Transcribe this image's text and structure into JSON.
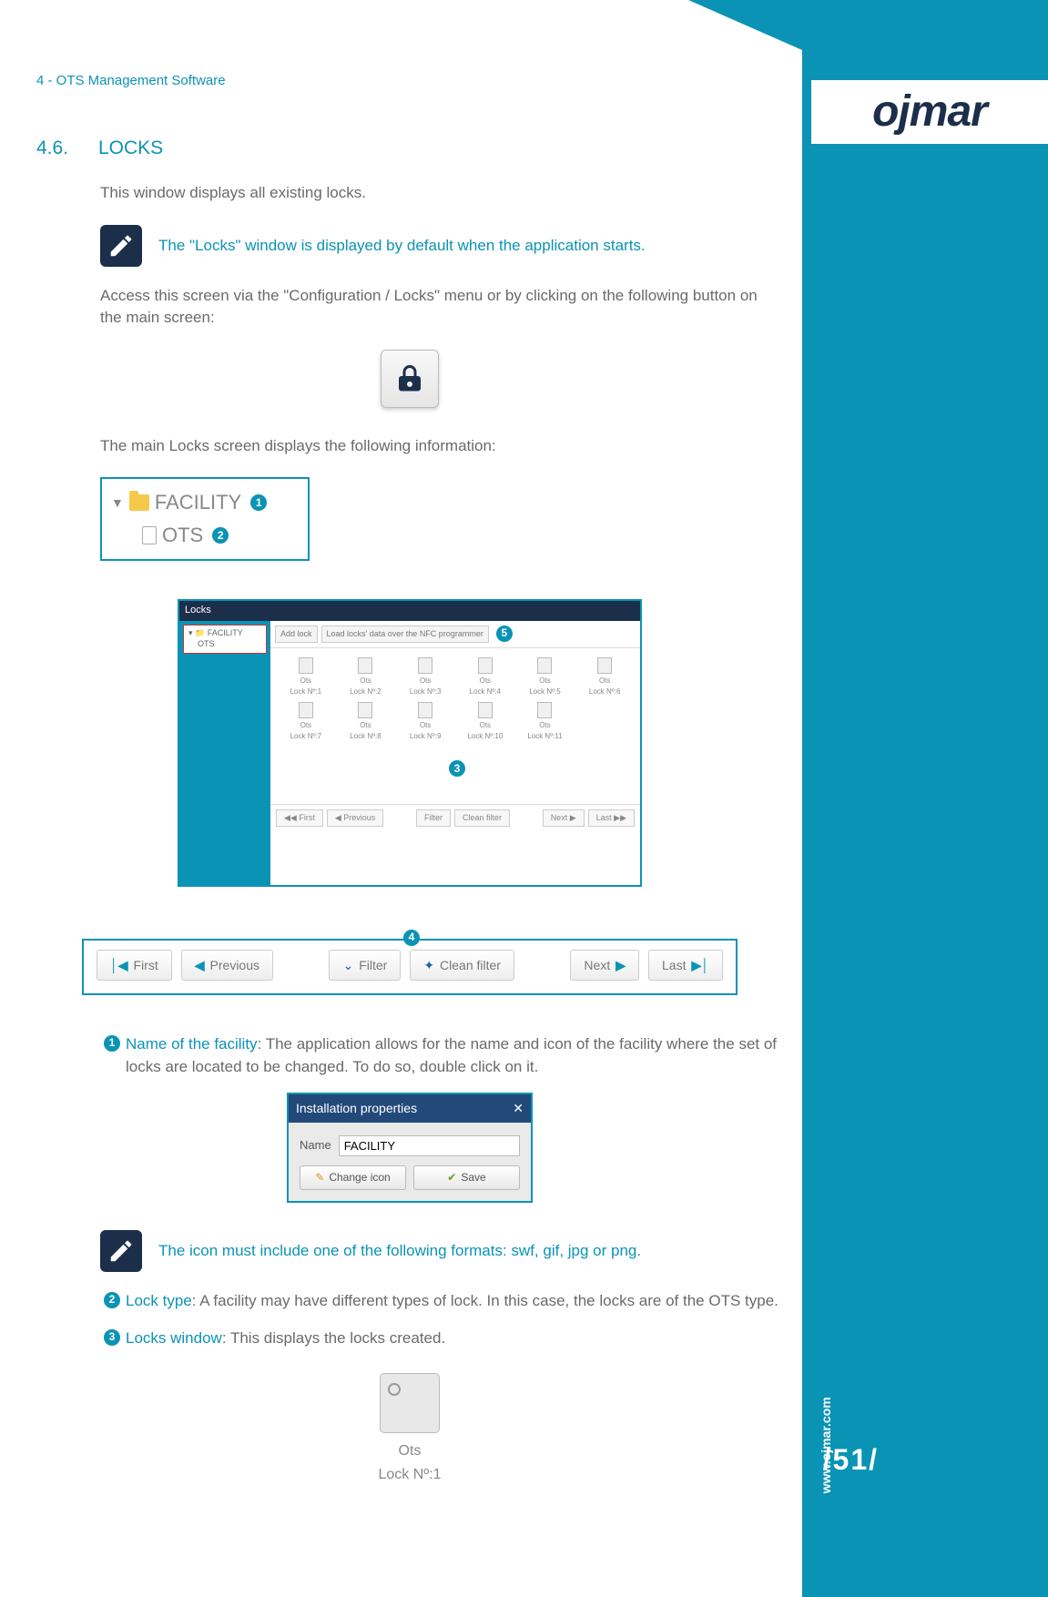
{
  "header": {
    "breadcrumb": "4 - OTS Management Software"
  },
  "logo": {
    "text": "ojmar"
  },
  "side": {
    "url": "www.ojmar.com",
    "page": "/51/"
  },
  "section": {
    "number": "4.6.",
    "title": "LOCKS"
  },
  "intro": "This window displays all existing locks.",
  "note1": "The \"Locks\" window is displayed by default when the application starts.",
  "access1": "Access this screen via the \"Configuration / Locks\" menu or by clicking on the following button on the main screen:",
  "mainInfo": "The main Locks screen displays the following information:",
  "tree": {
    "facility": "FACILITY",
    "ots": "OTS"
  },
  "locksWindow": {
    "title": "Locks",
    "sideTree": {
      "top": "▾ 📁 FACILITY",
      "sub": "OTS"
    },
    "topButtons": [
      "Add lock",
      "Load locks' data over the NFC programmer"
    ],
    "items": [
      {
        "t": "Ots",
        "n": "Lock Nº:1"
      },
      {
        "t": "Ots",
        "n": "Lock Nº:2"
      },
      {
        "t": "Ots",
        "n": "Lock Nº:3"
      },
      {
        "t": "Ots",
        "n": "Lock Nº:4"
      },
      {
        "t": "Ots",
        "n": "Lock Nº:5"
      },
      {
        "t": "Ots",
        "n": "Lock Nº:6"
      },
      {
        "t": "Ots",
        "n": "Lock Nº:7"
      },
      {
        "t": "Ots",
        "n": "Lock Nº:8"
      },
      {
        "t": "Ots",
        "n": "Lock Nº:9"
      },
      {
        "t": "Ots",
        "n": "Lock Nº:10"
      },
      {
        "t": "Ots",
        "n": "Lock Nº:11"
      }
    ],
    "bottom": {
      "first": "First",
      "prev": "Previous",
      "filter": "Filter",
      "clean": "Clean filter",
      "next": "Next",
      "last": "Last"
    }
  },
  "navbar": {
    "first": "First",
    "prev": "Previous",
    "filter": "Filter",
    "clean": "Clean filter",
    "next": "Next",
    "last": "Last"
  },
  "bullets": {
    "b1": {
      "label": "Name of the facility",
      "text": ": The application allows for the name and icon of the facility where the set of locks are located to be changed. To do so, double click on it."
    },
    "b2": {
      "label": "Lock type",
      "text": ": A facility may have different types of lock. In this case, the locks are of the OTS type."
    },
    "b3": {
      "label": "Locks window",
      "text": ": This displays the locks created."
    }
  },
  "dialog": {
    "title": "Installation properties",
    "nameLabel": "Name",
    "nameValue": "FACILITY",
    "changeIcon": "Change icon",
    "save": "Save"
  },
  "note2": "The icon must include one of the following formats: swf, gif, jpg or png.",
  "singleLock": {
    "type": "Ots",
    "num": "Lock Nº:1"
  }
}
